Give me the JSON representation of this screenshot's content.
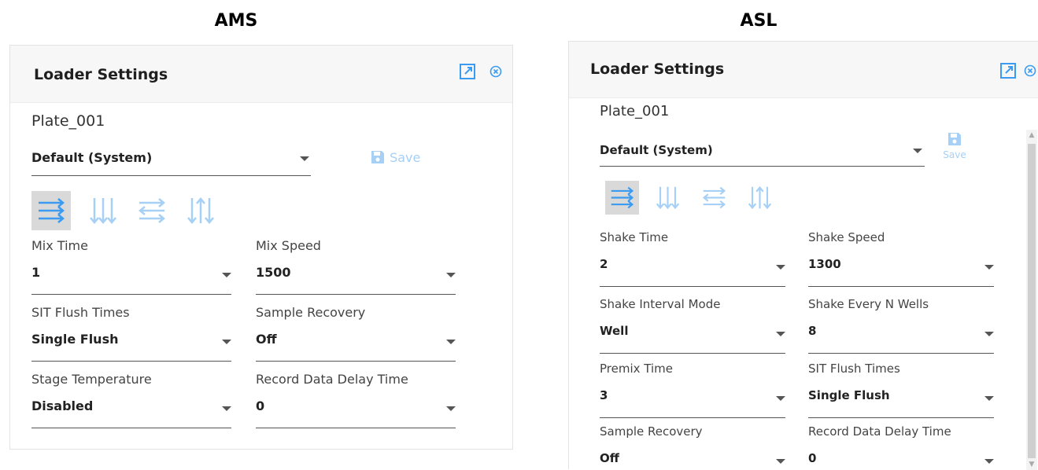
{
  "ams": {
    "heading": "AMS",
    "panel_title": "Loader Settings",
    "plate": "Plate_001",
    "preset": "Default (System)",
    "save_label": "Save",
    "fields": [
      {
        "label": "Mix Time",
        "value": "1"
      },
      {
        "label": "Mix Speed",
        "value": "1500"
      },
      {
        "label": "SIT Flush Times",
        "value": "Single Flush"
      },
      {
        "label": "Sample Recovery",
        "value": "Off"
      },
      {
        "label": "Stage Temperature",
        "value": "Disabled"
      },
      {
        "label": "Record Data Delay Time",
        "value": "0"
      }
    ]
  },
  "asl": {
    "heading": "ASL",
    "panel_title": "Loader Settings",
    "plate": "Plate_001",
    "preset": "Default (System)",
    "save_label": "Save",
    "fields": [
      {
        "label": "Shake Time",
        "value": "2"
      },
      {
        "label": "Shake Speed",
        "value": "1300"
      },
      {
        "label": "Shake Interval Mode",
        "value": "Well"
      },
      {
        "label": "Shake Every N Wells",
        "value": "8"
      },
      {
        "label": "Premix Time",
        "value": "3"
      },
      {
        "label": "SIT Flush Times",
        "value": "Single Flush"
      },
      {
        "label": "Sample Recovery",
        "value": "Off"
      },
      {
        "label": "Record Data Delay Time",
        "value": "0"
      }
    ]
  },
  "icons": {
    "open_external": "external-link-icon",
    "close": "close-circle-icon",
    "save": "floppy-disk-icon",
    "mode_1": "horizontal-arrows-right-icon",
    "mode_2": "vertical-arrows-down-icon",
    "mode_3": "horizontal-arrows-alternating-icon",
    "mode_4": "vertical-arrows-alternating-icon"
  },
  "colors": {
    "accent": "#3a9bf0",
    "accent_light": "#a6d0f5",
    "active_mode_bg": "#d9d9d9",
    "header_bg": "#f7f7f7"
  }
}
